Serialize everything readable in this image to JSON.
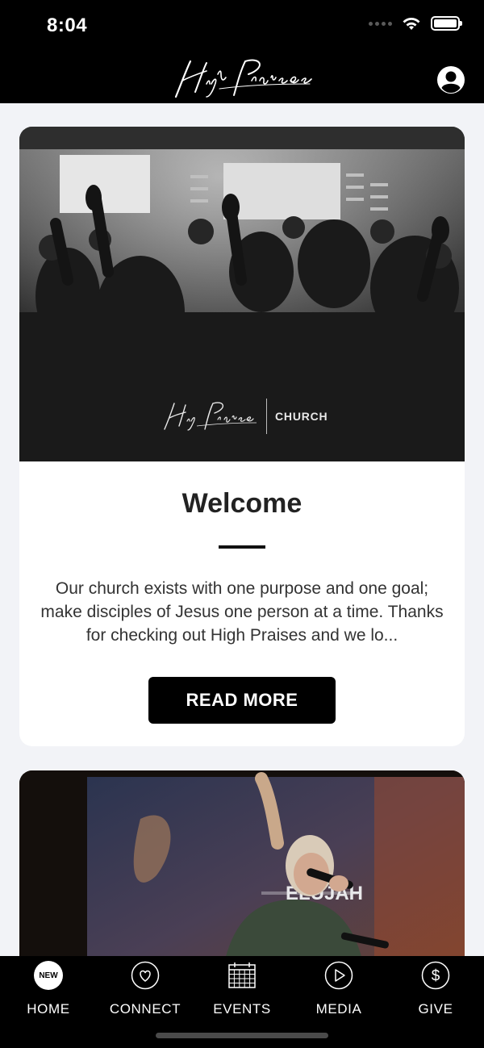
{
  "status": {
    "time": "8:04"
  },
  "header": {
    "logo_text": "High Praises"
  },
  "cards": [
    {
      "image_logo_script": "High Praises",
      "image_logo_church": "CHURCH",
      "title": "Welcome",
      "body": "Our church exists with one purpose and one goal; make disciples of Jesus one person at a time. Thanks for checking out High Praises and we lo...",
      "button_label": "READ MORE"
    },
    {
      "screen_text": "ELUJAH"
    }
  ],
  "tabs": [
    {
      "label": "HOME",
      "icon": "new-badge-icon",
      "badge": "NEW"
    },
    {
      "label": "CONNECT",
      "icon": "heart-icon"
    },
    {
      "label": "EVENTS",
      "icon": "calendar-icon"
    },
    {
      "label": "MEDIA",
      "icon": "play-icon"
    },
    {
      "label": "GIVE",
      "icon": "dollar-icon"
    }
  ],
  "colors": {
    "bar": "#000000",
    "background": "#f2f3f7",
    "card": "#ffffff",
    "button": "#000000"
  }
}
